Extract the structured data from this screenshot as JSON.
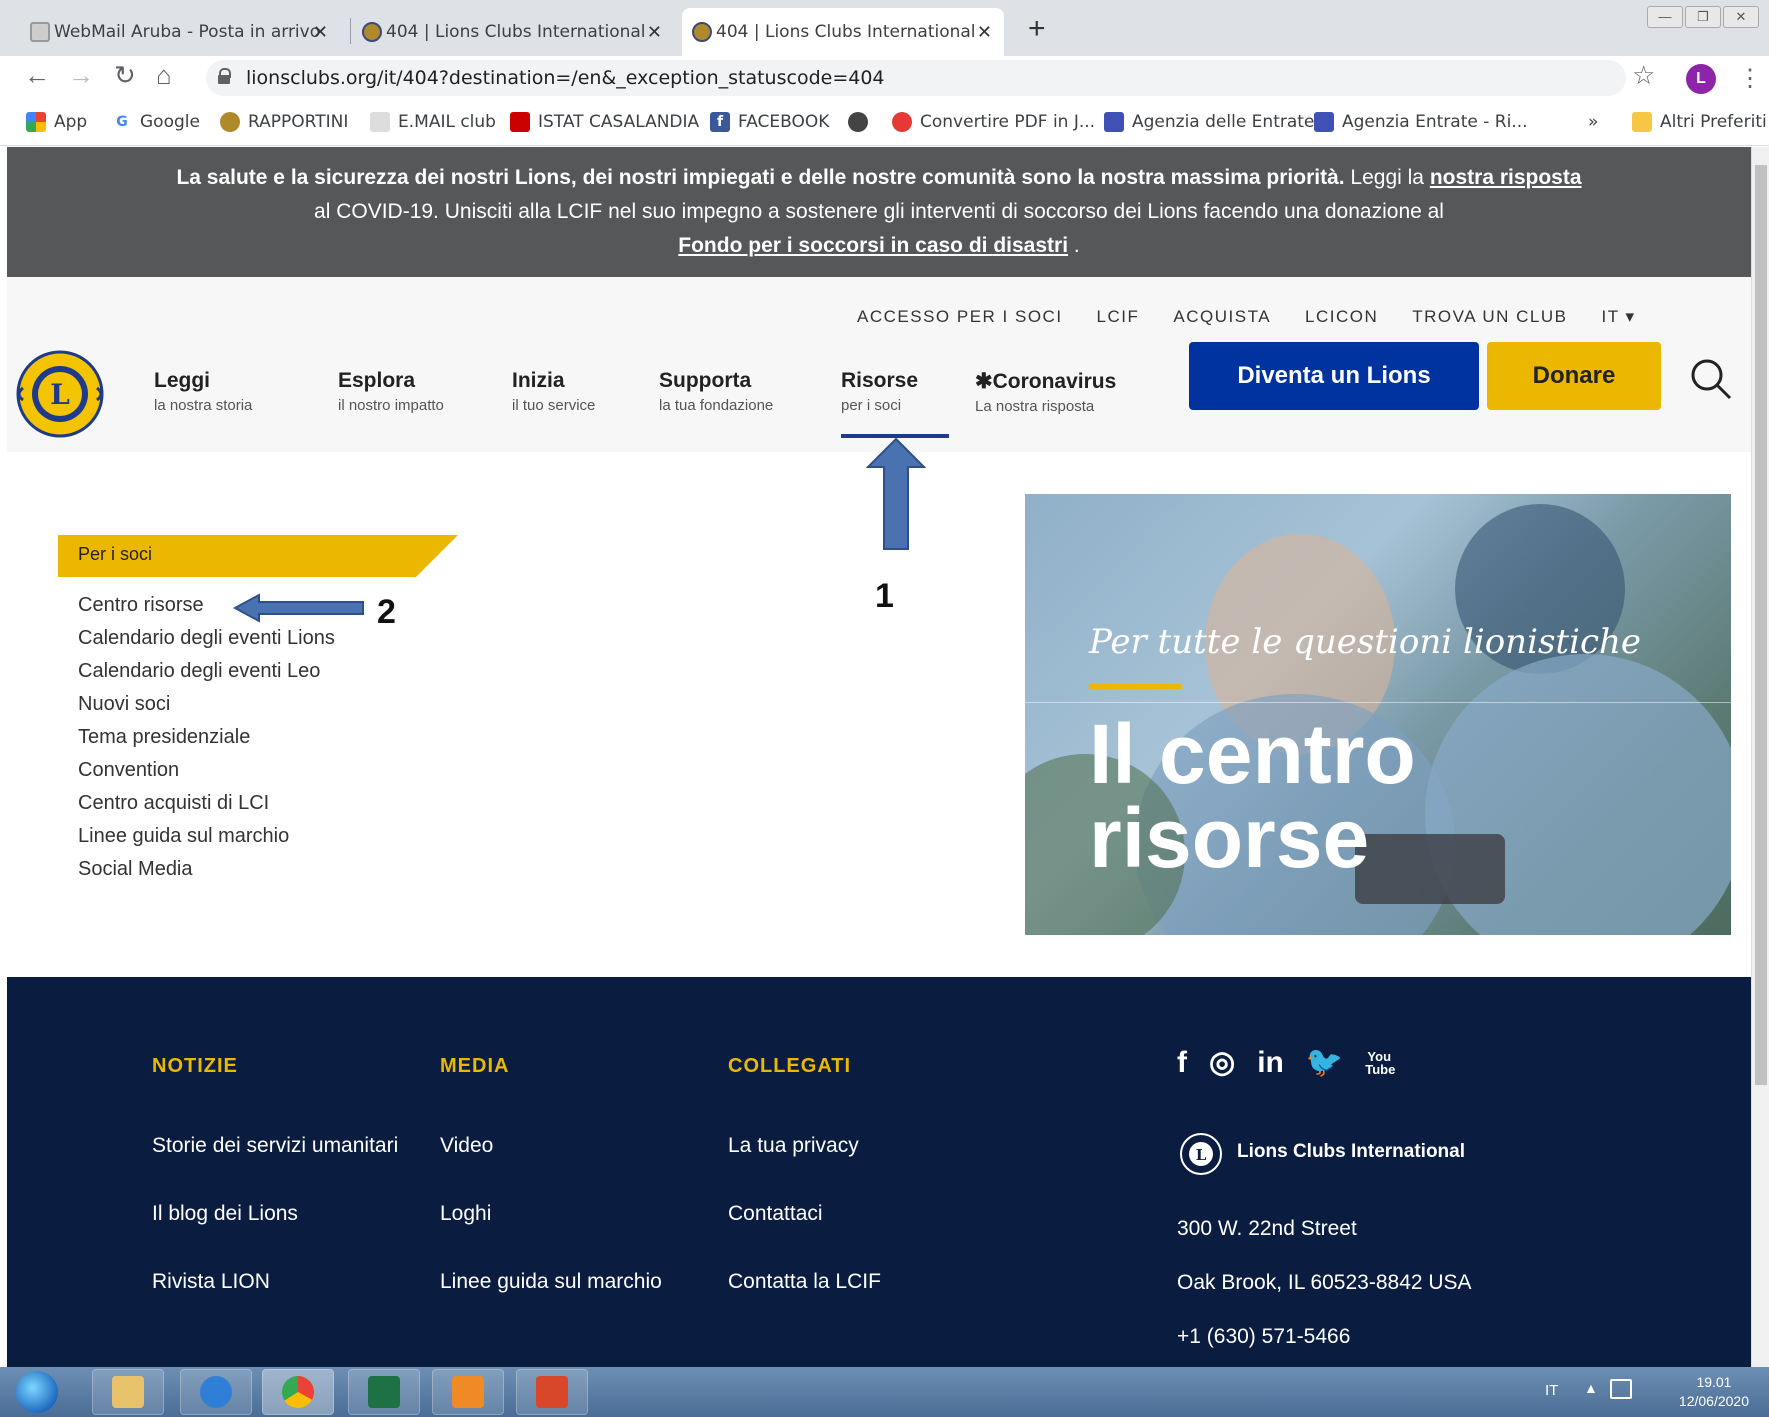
{
  "browser": {
    "tabs": [
      {
        "title": "WebMail Aruba - Posta in arrivo"
      },
      {
        "title": "404 | Lions Clubs International"
      },
      {
        "title": "404 | Lions Clubs International"
      }
    ],
    "new_tab": "+",
    "url": "lionsclubs.org/it/404?destination=/en&_exception_statuscode=404",
    "profile_initial": "L",
    "bookmarks": [
      "App",
      "Google",
      "RAPPORTINI",
      "E.MAIL club",
      "ISTAT CASALANDIA",
      "FACEBOOK",
      "Convertire PDF in J...",
      "Agenzia delle Entrate",
      "Agenzia Entrate - Ri...",
      "Altri Preferiti"
    ],
    "bookmarks_more": "»"
  },
  "covid_banner": {
    "bold_text": "La salute e la sicurezza dei nostri Lions, dei nostri impiegati e delle nostre comunità sono la nostra massima priorità.",
    "text_read": " Leggi la ",
    "link_response": "nostra risposta",
    "text_middle": "al COVID-19. Unisciti alla LCIF nel suo impegno a sostenere gli interventi di soccorso dei Lions facendo una donazione al",
    "link_fund": "Fondo per i soccorsi in caso di disastri",
    "text_end": " ."
  },
  "header": {
    "top_links": [
      "ACCESSO PER I SOCI",
      "LCIF",
      "ACQUISTA",
      "LCICON",
      "TROVA UN CLUB",
      "IT ▾"
    ],
    "menu": [
      {
        "title": "Leggi",
        "sub": "la nostra storia"
      },
      {
        "title": "Esplora",
        "sub": "il nostro impatto"
      },
      {
        "title": "Inizia",
        "sub": "il tuo service"
      },
      {
        "title": "Supporta",
        "sub": "la tua fondazione"
      },
      {
        "title": "Risorse",
        "sub": "per i soci"
      },
      {
        "title": "✱Coronavirus",
        "sub": "La nostra risposta"
      }
    ],
    "join_button": "Diventa un Lions",
    "donate_button": "Donare"
  },
  "annotations": {
    "one": "1",
    "two": "2"
  },
  "sidebar": {
    "heading": "Per i soci",
    "items": [
      "Centro risorse",
      "Calendario degli eventi Lions",
      "Calendario degli eventi Leo",
      "Nuovi soci",
      "Tema presidenziale",
      "Convention",
      "Centro acquisti di LCI",
      "Linee guida sul marchio",
      "Social Media"
    ]
  },
  "hero": {
    "tagline": "Per tutte le questioni lionistiche",
    "title_line1": "Il centro",
    "title_line2": "risorse"
  },
  "footer": {
    "columns": [
      {
        "title": "NOTIZIE",
        "links": [
          "Storie dei servizi umanitari",
          "Il blog dei Lions",
          "Rivista LION"
        ]
      },
      {
        "title": "MEDIA",
        "links": [
          "Video",
          "Loghi",
          "Linee guida sul marchio"
        ]
      },
      {
        "title": "COLLEGATI",
        "links": [
          "La tua privacy",
          "Contattaci",
          "Contatta la LCIF"
        ]
      }
    ],
    "social": [
      "f",
      "◎",
      "in",
      "🐦",
      "You Tube"
    ],
    "brand": "Lions Clubs International",
    "address1": "300 W. 22nd Street",
    "address2": "Oak Brook, IL 60523-8842 USA",
    "phone": "+1 (630) 571-5466"
  },
  "taskbar": {
    "lang": "IT",
    "time": "19.01",
    "date": "12/06/2020"
  },
  "colors": {
    "lions_blue": "#0033a0",
    "lions_gold": "#ebb700",
    "footer_navy": "#0a1d40",
    "banner_gray": "#555759",
    "annotation_arrow": "#4a72b0"
  }
}
